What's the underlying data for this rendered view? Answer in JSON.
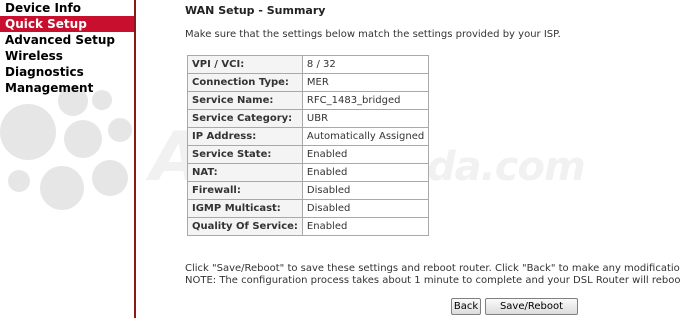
{
  "sidebar": {
    "items": [
      {
        "label": "Device Info"
      },
      {
        "label": "Quick Setup"
      },
      {
        "label": "Advanced Setup"
      },
      {
        "label": "Wireless"
      },
      {
        "label": "Diagnostics"
      },
      {
        "label": "Management"
      }
    ],
    "active_index": 1
  },
  "watermark": {
    "text": "ADSL",
    "suffix": "Ayuda.com"
  },
  "main": {
    "title": "WAN Setup - Summary",
    "intro": "Make sure that the settings below match the settings provided by your ISP.",
    "rows": [
      {
        "label": "VPI / VCI:",
        "value": "8 / 32"
      },
      {
        "label": "Connection Type:",
        "value": "MER"
      },
      {
        "label": "Service Name:",
        "value": "RFC_1483_bridged"
      },
      {
        "label": "Service Category:",
        "value": "UBR"
      },
      {
        "label": "IP Address:",
        "value": "Automatically Assigned"
      },
      {
        "label": "Service State:",
        "value": "Enabled"
      },
      {
        "label": "NAT:",
        "value": "Enabled"
      },
      {
        "label": "Firewall:",
        "value": "Disabled"
      },
      {
        "label": "IGMP Multicast:",
        "value": "Disabled"
      },
      {
        "label": "Quality Of Service:",
        "value": "Enabled"
      }
    ],
    "note_line1": "Click \"Save/Reboot\" to save these settings and reboot router. Click \"Back\" to make any modifications.",
    "note_line2": "NOTE: The configuration process takes about 1 minute to complete and your DSL Router will reboot."
  },
  "buttons": {
    "back": "Back",
    "save_reboot": "Save/Reboot"
  },
  "colors": {
    "active_menu": "#c8102e",
    "sidebar_border": "#8a1a1a"
  }
}
